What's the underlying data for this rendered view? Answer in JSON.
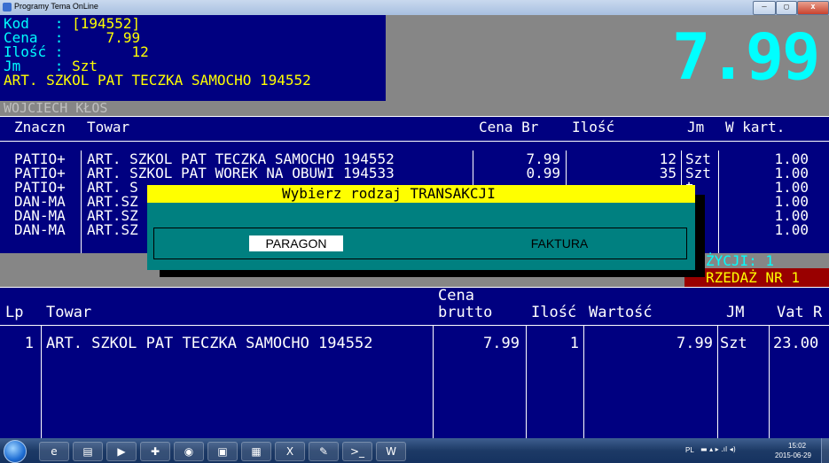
{
  "window": {
    "title": "Programy Tema OnLine",
    "controls": {
      "minimize": "—",
      "maximize": "▢",
      "close": "x"
    }
  },
  "colors": {
    "console_bg": "#000080",
    "accent_yellow": "#ffff00",
    "accent_cyan": "#00ffff",
    "dialog_bg": "#008080",
    "grey": "#868686",
    "status_red": "#990000"
  },
  "product_info": {
    "kod_label": "Kod   : ",
    "kod_value": "[194552]",
    "cena_label": "Cena  :     ",
    "cena_value": "7.99",
    "ilosc_label": "Ilość :        ",
    "ilosc_value": "12",
    "jm_label": "Jm    : ",
    "jm_value": "Szt",
    "name": "ART. SZKOL PAT TECZKA SAMOCHO 194552"
  },
  "big_price": "7.99",
  "customer": "WOJCIECH KŁOS",
  "table1": {
    "headers": {
      "znaczn": "Znaczn",
      "towar": "Towar",
      "cena_br": "Cena Br",
      "ilosc": "Ilość",
      "jm": "Jm",
      "w_kart": "W kart."
    },
    "rows": [
      {
        "znaczn": "PATIO+",
        "towar": "ART. SZKOL PAT TECZKA SAMOCHO 194552",
        "cena": "7.99",
        "ilosc": "12",
        "jm": "Szt",
        "w_kart": "1.00"
      },
      {
        "znaczn": "PATIO+",
        "towar": "ART. SZKOL PAT WOREK NA OBUWI 194533",
        "cena": "0.99",
        "ilosc": "35",
        "jm": "Szt",
        "w_kart": "1.00"
      },
      {
        "znaczn": "PATIO+",
        "towar": "ART. S",
        "cena": "",
        "ilosc": "",
        "jm": "t",
        "w_kart": "1.00"
      },
      {
        "znaczn": "DAN-MA",
        "towar": "ART.SZ",
        "cena": "",
        "ilosc": "",
        "jm": "t",
        "w_kart": "1.00"
      },
      {
        "znaczn": "DAN-MA",
        "towar": "ART.SZ",
        "cena": "",
        "ilosc": "",
        "jm": "t",
        "w_kart": "1.00"
      },
      {
        "znaczn": "DAN-MA",
        "towar": "ART.SZ",
        "cena": "",
        "ilosc": "",
        "jm": "t",
        "w_kart": "1.00"
      }
    ]
  },
  "status": {
    "line1": "ŻYCJI: 1",
    "line2": "RZEDAŻ NR 1"
  },
  "table2": {
    "headers": {
      "lp": "Lp",
      "towar": "Towar",
      "cena_top": "Cena",
      "cena_bottom": "brutto",
      "ilosc": "Ilość",
      "wartosc": "Wartość",
      "jm": "JM",
      "vat": "Vat R"
    },
    "rows": [
      {
        "lp": "1",
        "towar": "ART. SZKOL PAT TECZKA SAMOCHO 194552",
        "cena": "7.99",
        "ilosc": "1",
        "wartosc": "7.99",
        "jm": "Szt",
        "vat": "23.00"
      }
    ]
  },
  "dialog": {
    "title": "Wybierz rodzaj TRANSAKCJI",
    "option_paragon": "PARAGON",
    "option_faktura": "FAKTURA"
  },
  "taskbar": {
    "items": [
      {
        "name": "ie-icon",
        "glyph": "e"
      },
      {
        "name": "explorer-icon",
        "glyph": "▤"
      },
      {
        "name": "media-player-icon",
        "glyph": "▶"
      },
      {
        "name": "antivirus-icon",
        "glyph": "✚"
      },
      {
        "name": "firefox-icon",
        "glyph": "◉"
      },
      {
        "name": "app-red-icon",
        "glyph": "▣"
      },
      {
        "name": "app-yellow-icon",
        "glyph": "▦"
      },
      {
        "name": "excel-icon",
        "glyph": "X"
      },
      {
        "name": "paint-icon",
        "glyph": "✎"
      },
      {
        "name": "console-icon",
        "glyph": ">_"
      },
      {
        "name": "word-icon",
        "glyph": "W"
      }
    ],
    "tray_lang": "PL",
    "tray_icons": "▬ ▴ ▸ .ıl ◂)",
    "clock_time": "15:02",
    "clock_date": "2015-06-29"
  }
}
